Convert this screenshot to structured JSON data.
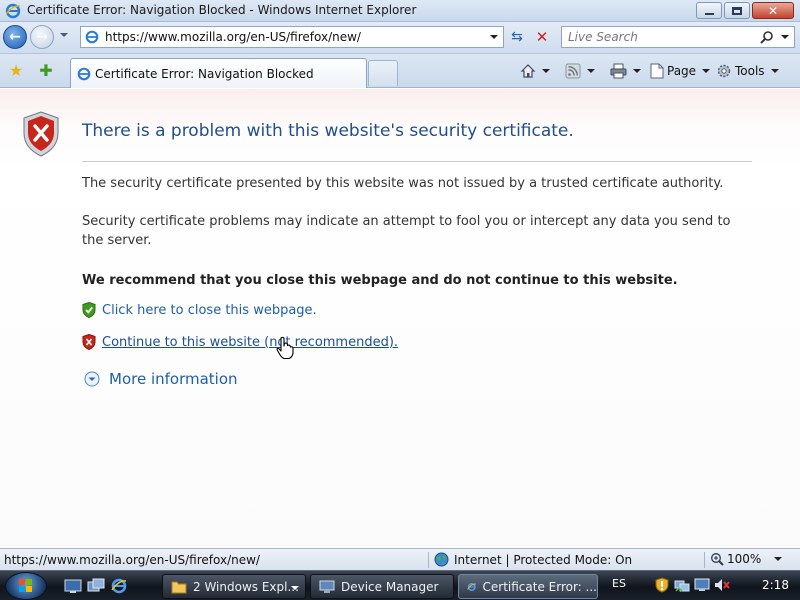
{
  "window": {
    "title": "Certificate Error: Navigation Blocked - Windows Internet Explorer"
  },
  "address_bar": {
    "url": "https://www.mozilla.org/en-US/firefox/new/"
  },
  "search": {
    "placeholder": "Live Search"
  },
  "tabs": [
    {
      "label": "Certificate Error: Navigation Blocked"
    }
  ],
  "command_bar": {
    "page_label": "Page",
    "tools_label": "Tools"
  },
  "content": {
    "heading": "There is a problem with this website's security certificate.",
    "paragraph1": "The security certificate presented by this website was not issued by a trusted certificate authority.",
    "paragraph2": "Security certificate problems may indicate an attempt to fool you or intercept any data you send to the server.",
    "recommendation": "We recommend that you close this webpage and do not continue to this website.",
    "close_link": "Click here to close this webpage.",
    "continue_link": "Continue to this website (not recommended).",
    "more_info": "More information"
  },
  "status_bar": {
    "url": "https://www.mozilla.org/en-US/firefox/new/",
    "zone": "Internet | Protected Mode: On",
    "zoom": "100%"
  },
  "taskbar": {
    "tasks": [
      {
        "label": "2 Windows Expl..."
      },
      {
        "label": "Device Manager"
      },
      {
        "label": "Certificate Error: ..."
      }
    ],
    "language": "ES",
    "clock": "2:18"
  },
  "colors": {
    "link": "#1f5fa8",
    "heading": "#1f4f8c",
    "error_shield": "#c8251b",
    "ok_shield": "#3f9b1e"
  }
}
